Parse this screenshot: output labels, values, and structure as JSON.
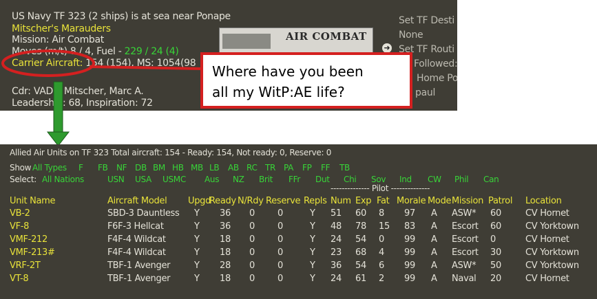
{
  "tf_panel": {
    "line1": "US Navy TF 323 (2 ships) is at sea near Ponape",
    "tf_name": "Mitscher's Marauders",
    "mission": "Mission: Air Combat",
    "moves_label": "Moves (m/t) 8 / 4, Fuel - ",
    "fuel_value": "229 / 24 (4)",
    "carrier_label": "Carrier Aircraft:",
    "carrier_value": " 154 (154), MS: 1054(98",
    "commander": "Cdr: VADM Mitscher, Marc A.",
    "leadership": "Leadership: 68, Inspiration: 72",
    "banner_title": "AIR COMBAT",
    "right_menu": [
      "Set TF Desti",
      "None",
      "Set TF Routi",
      "Followed:",
      "Home Po",
      "paul"
    ],
    "arrow_icon": "right-arrow-icon"
  },
  "callout": {
    "line1": "Where have you been",
    "line2": "all my WitP:AE life?"
  },
  "air_units": {
    "summary": "Allied Air Units on TF 323  Total aircraft:  154 - Ready:  154, Not ready:  0, Reserve:  0",
    "show_label": "Show",
    "show_filters": [
      "All Types",
      "F",
      "FB",
      "NF",
      "DB",
      "BM",
      "HB",
      "MB",
      "LB",
      "AB",
      "RC",
      "TR",
      "PA",
      "FP",
      "FF",
      "TB"
    ],
    "select_label": "Select:",
    "select_filters": [
      "All Nations",
      "USN",
      "USA",
      "USMC",
      "Aus",
      "NZ",
      "Brit",
      "FFr",
      "Dut",
      "Chi",
      "Sov",
      "Ind",
      "CW",
      "Phil",
      "Can"
    ],
    "pilot_group": "-------------- Pilot --------------",
    "headers": [
      "Unit Name",
      "Aircraft Model",
      "Upgd",
      "Ready",
      "N/Rdy",
      "Reserve",
      "Repls",
      "Num",
      "Exp",
      "Fat",
      "Morale",
      "Mode",
      "Mission",
      "Patrol",
      "Location"
    ],
    "rows": [
      [
        "VB-2",
        "SBD-3 Dauntless",
        "Y",
        "36",
        "0",
        "0",
        "Y",
        "51",
        "60",
        "8",
        "97",
        "A",
        "ASW*",
        "60",
        "CV Hornet"
      ],
      [
        "VF-8",
        "F6F-3 Hellcat",
        "Y",
        "36",
        "0",
        "0",
        "Y",
        "48",
        "78",
        "15",
        "83",
        "A",
        "Escort",
        "60",
        "CV Yorktown"
      ],
      [
        "VMF-212",
        "F4F-4 Wildcat",
        "Y",
        "18",
        "0",
        "0",
        "Y",
        "24",
        "54",
        "0",
        "99",
        "A",
        "Escort",
        "0",
        "CV Hornet"
      ],
      [
        "VMF-213#",
        "F4F-4 Wildcat",
        "Y",
        "18",
        "0",
        "0",
        "Y",
        "23",
        "68",
        "4",
        "99",
        "A",
        "Escort",
        "30",
        "CV Yorktown"
      ],
      [
        "VRF-2T",
        "TBF-1 Avenger",
        "Y",
        "28",
        "0",
        "0",
        "Y",
        "36",
        "54",
        "6",
        "99",
        "A",
        "ASW*",
        "50",
        "CV Yorktown"
      ],
      [
        "VT-8",
        "TBF-1 Avenger",
        "Y",
        "18",
        "0",
        "0",
        "Y",
        "24",
        "61",
        "2",
        "99",
        "A",
        "Naval",
        "20",
        "CV Hornet"
      ]
    ]
  },
  "colors": {
    "panel": "#3f3d35",
    "yellow": "#e8e23a",
    "green": "#38d438",
    "callout_border": "#d42020",
    "arrow": "#2e9a2e"
  }
}
